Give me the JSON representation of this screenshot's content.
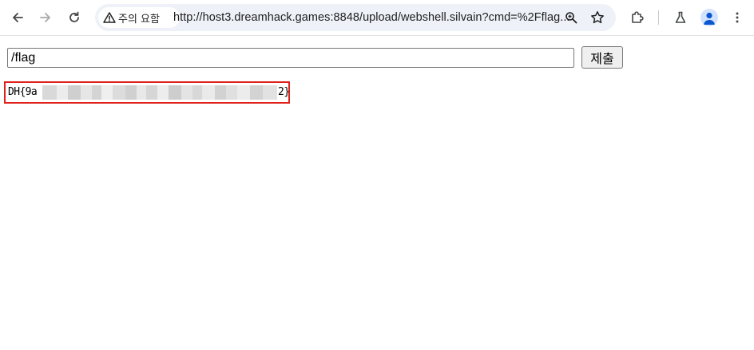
{
  "browser": {
    "security_chip": {
      "label": "주의 요함",
      "icon": "warning-triangle-icon"
    },
    "url": "http://host3.dreamhack.games:8848/upload/webshell.silvain?cmd=%2Fflag...",
    "icons": [
      "back-arrow-icon",
      "forward-arrow-icon",
      "reload-icon",
      "zoom-icon",
      "bookmark-star-icon",
      "extensions-puzzle-icon",
      "labs-flask-icon",
      "profile-avatar-icon",
      "menu-kebab-icon"
    ]
  },
  "form": {
    "cmd_value": "/flag",
    "submit_label": "제출"
  },
  "result": {
    "prefix": "DH{9a",
    "suffix": "2}",
    "redacted": true,
    "highlight_color": "#e0201c"
  }
}
